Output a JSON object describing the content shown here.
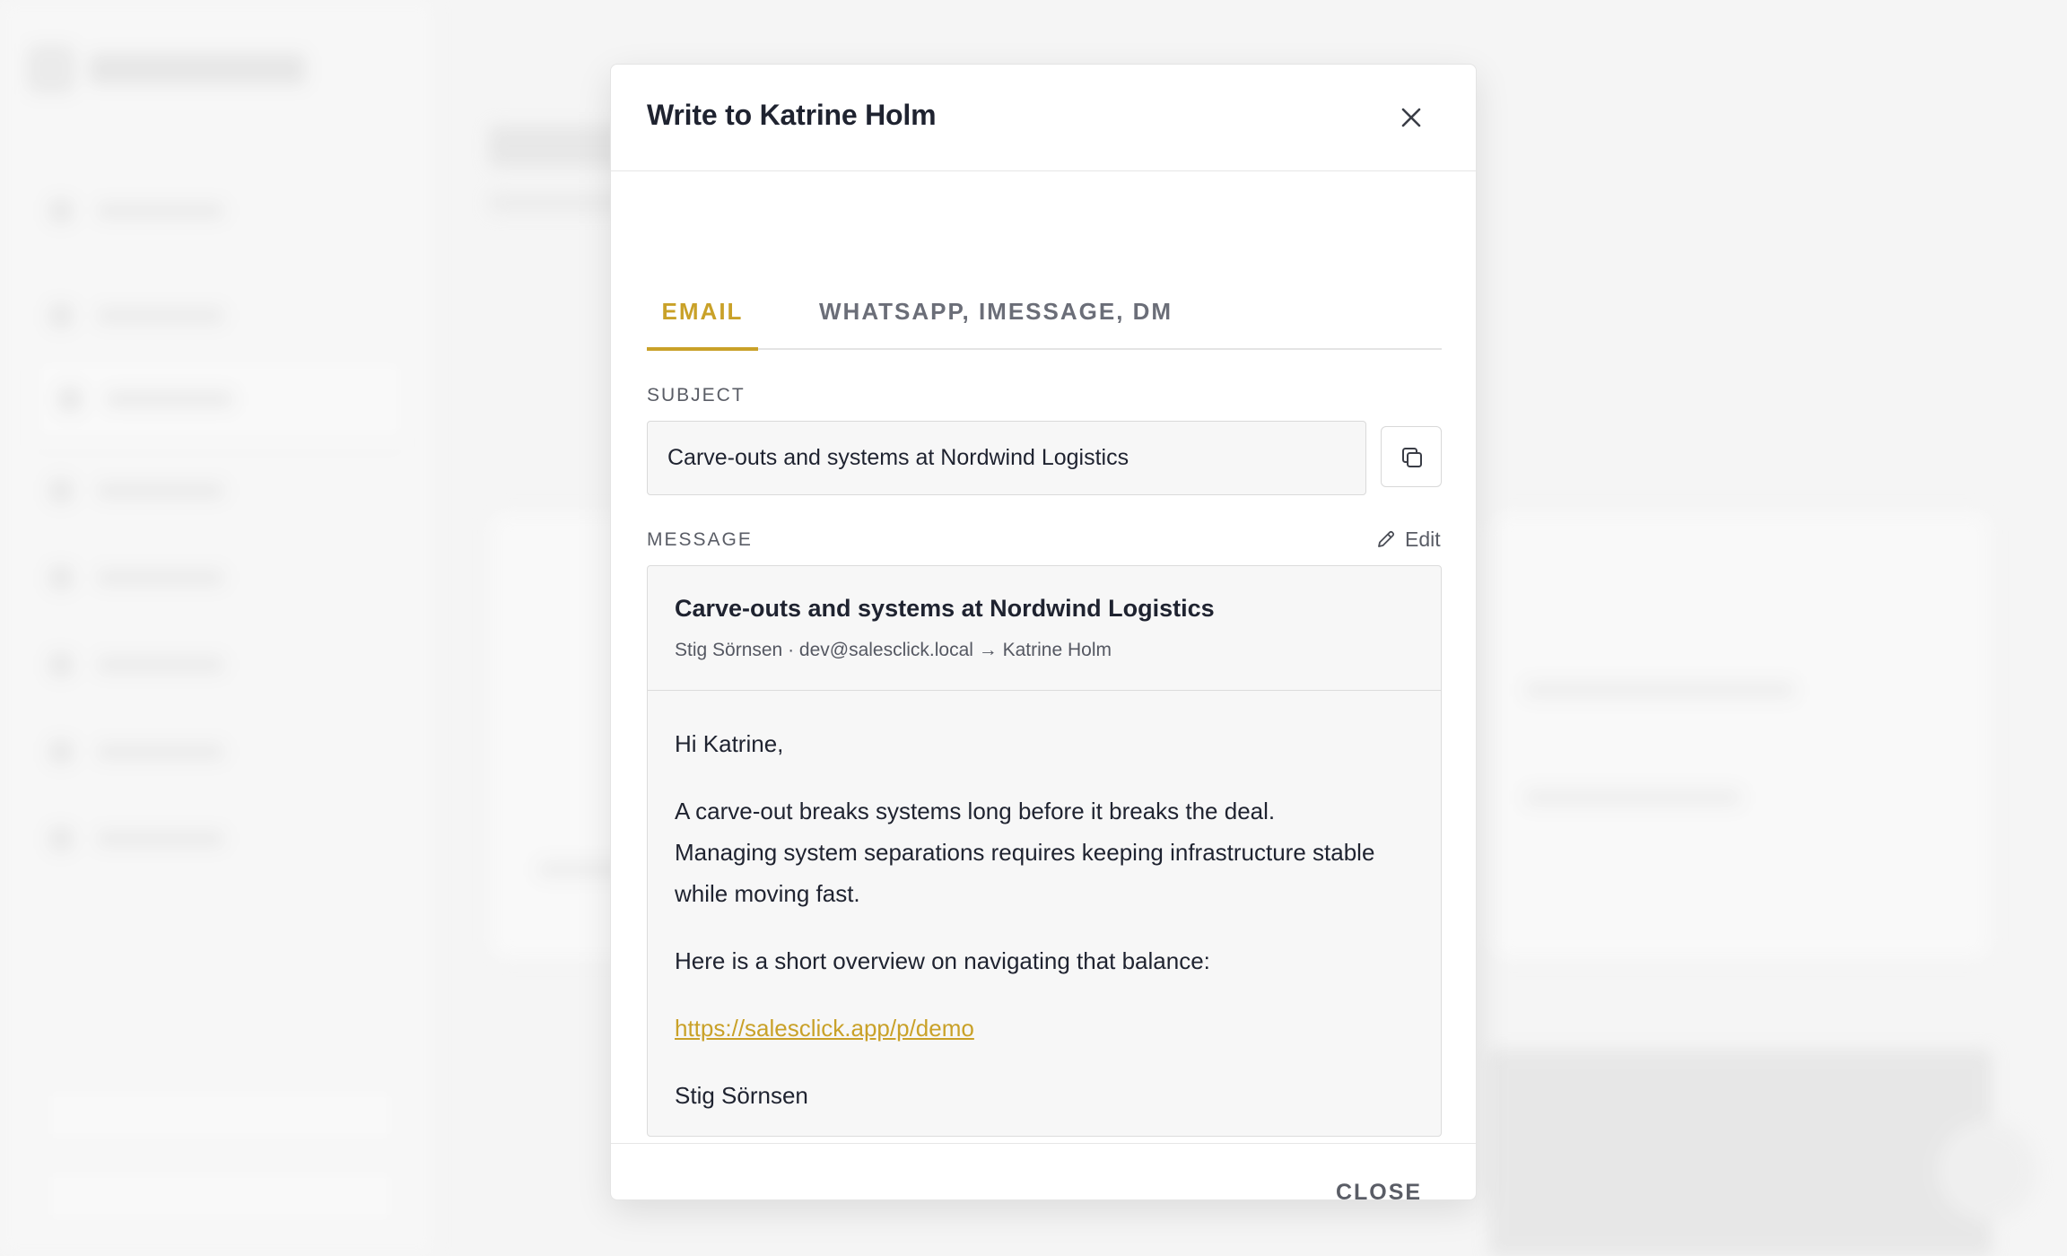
{
  "modal": {
    "title": "Write to Katrine Holm",
    "tabs": [
      {
        "label": "EMAIL",
        "active": true
      },
      {
        "label": "WHATSAPP, IMESSAGE, DM",
        "active": false
      }
    ],
    "subject": {
      "label": "SUBJECT",
      "value": "Carve-outs and systems at Nordwind Logistics"
    },
    "message": {
      "label": "MESSAGE",
      "edit_label": "Edit",
      "subject": "Carve-outs and systems at Nordwind Logistics",
      "meta": "Stig Sörnsen · dev@salesclick.local → Katrine Holm",
      "greeting": "Hi Katrine,",
      "paragraph1_line1": "A carve-out breaks systems long before it breaks the deal.",
      "paragraph1_line2": "Managing system separations requires keeping infrastructure stable",
      "paragraph1_line3": "while moving fast.",
      "paragraph2": "Here is a short overview on navigating that balance:",
      "link": "https://salesclick.app/p/demo",
      "signature": "Stig Sörnsen"
    },
    "close_label": "CLOSE"
  },
  "icons": {
    "close": "close-icon",
    "copy": "copy-icon",
    "edit": "pencil-icon"
  },
  "colors": {
    "accent": "#c9a128",
    "text": "#1f2330",
    "muted": "#5a5d66"
  }
}
